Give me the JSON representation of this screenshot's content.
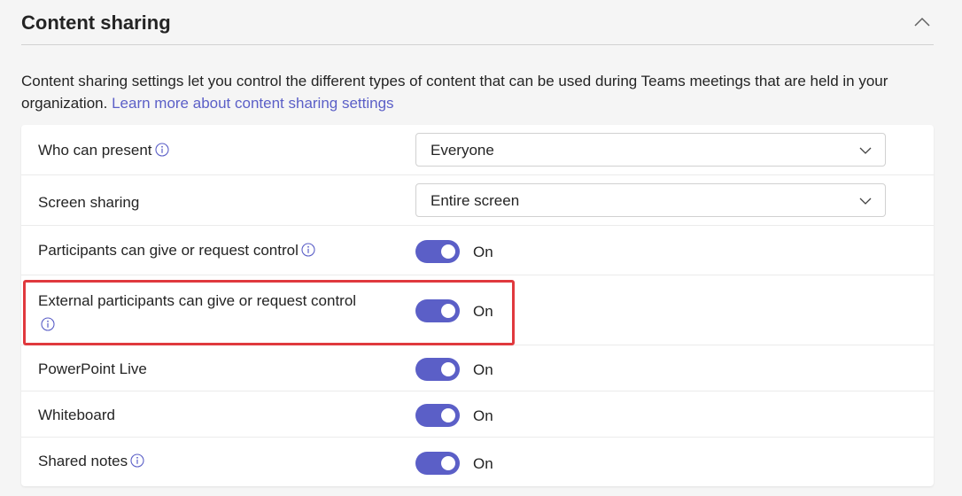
{
  "section": {
    "title": "Content sharing",
    "collapse_icon": "chevron-up-icon"
  },
  "description": {
    "text": "Content sharing settings let you control the different types of content that can be used during Teams meetings that are held in your organization.",
    "link": "Learn more about content sharing settings"
  },
  "settings": {
    "who_can_present": {
      "label": "Who can present",
      "value": "Everyone",
      "info_icon": "info-icon"
    },
    "screen_sharing": {
      "label": "Screen sharing",
      "value": "Entire screen"
    },
    "participants_control": {
      "label": "Participants can give or request control",
      "state": "On",
      "info_icon": "info-icon"
    },
    "external_control": {
      "label": "External participants can give or request control",
      "state": "On",
      "info_icon": "info-icon"
    },
    "powerpoint_live": {
      "label": "PowerPoint Live",
      "state": "On"
    },
    "whiteboard": {
      "label": "Whiteboard",
      "state": "On"
    },
    "shared_notes": {
      "label": "Shared notes",
      "state": "On",
      "info_icon": "info-icon"
    }
  },
  "colors": {
    "accent": "#5b5fc7",
    "highlight": "#e0393e"
  }
}
